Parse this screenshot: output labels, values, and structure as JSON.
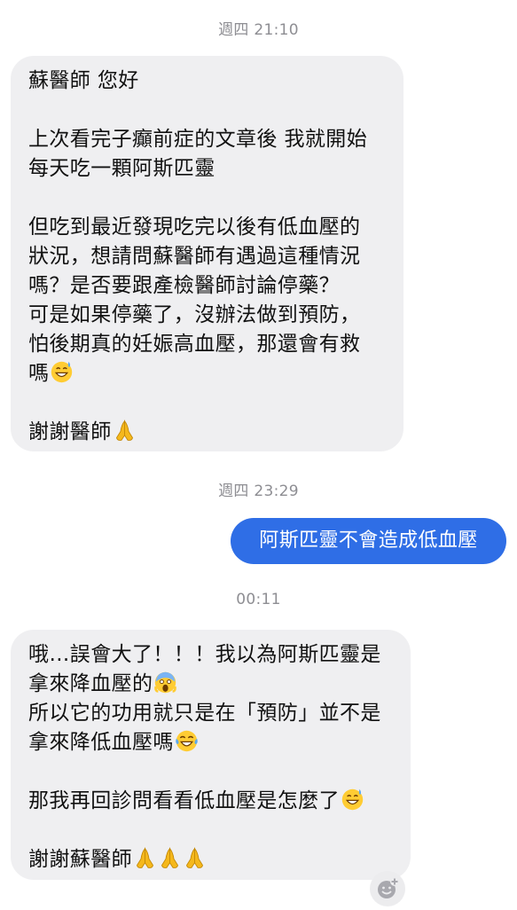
{
  "conversation": {
    "ts1": "週四 21:10",
    "msg1": {
      "l1": "蘇醫師 您好",
      "l2": "上次看完子癲前症的文章後 我就開始",
      "l3": "每天吃一顆阿斯匹靈",
      "l4": "但吃到最近發現吃完以後有低血壓的",
      "l5": "狀況，想請問蘇醫師有遇過這種情況",
      "l6": "嗎？是否要跟產檢醫師討論停藥？",
      "l7": "可是如果停藥了，沒辦法做到預防，",
      "l8": "怕後期真的妊娠高血壓，那還會有救",
      "l9": "嗎",
      "l9_emoji": "grinning-sweat-emoji",
      "l10": "謝謝醫師",
      "l10_emoji": "folded-hands-emoji"
    },
    "ts2": "週四 23:29",
    "reply": "阿斯匹靈不會造成低血壓",
    "ts3": "00:11",
    "msg2": {
      "l1": "哦…誤會大了！！！我以為阿斯匹靈是",
      "l2": "拿來降血壓的",
      "l2_emoji": "screaming-face-emoji",
      "l3": "所以它的功用就只是在「預防」並不是",
      "l4": "拿來降低血壓嗎",
      "l4_emoji": "tears-of-joy-emoji",
      "l5": "那我再回診問看看低血壓是怎麼了",
      "l5_emoji": "grinning-sweat-emoji",
      "l6": "謝謝蘇醫師",
      "l6_emoji": "folded-hands-emoji"
    },
    "react_icon": "add-reaction-icon"
  },
  "colors": {
    "incoming_bubble": "#efeff1",
    "outgoing_bubble": "#2f6ee6",
    "timestamp_text": "#8e8e93"
  }
}
